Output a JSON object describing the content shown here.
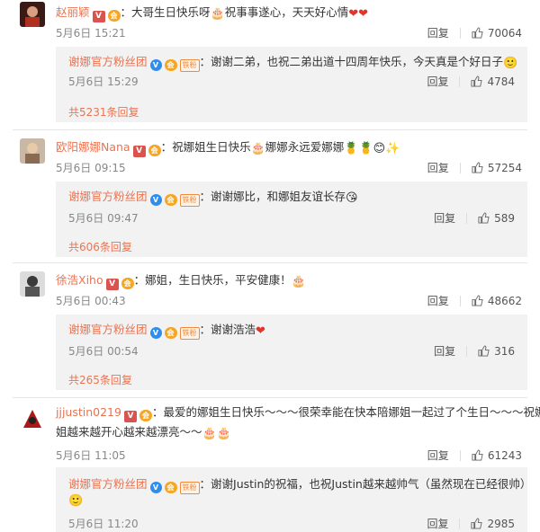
{
  "comments": [
    {
      "user": "赵丽颖",
      "text": "：大哥生日快乐呀",
      "text2": "祝事事遂心，天天好心情",
      "time": "5月6日 15:21",
      "reply_label": "回复",
      "likes": "70064",
      "sub": {
        "user": "谢娜官方粉丝团",
        "fan_tag": "铁粉",
        "text": "：谢谢二弟，也祝二弟出道十四周年快乐，今天真是个好日子",
        "time": "5月6日 15:29",
        "reply_label": "回复",
        "likes": "4784"
      },
      "more": "共5231条回复"
    },
    {
      "user": "欧阳娜娜Nana",
      "text": "：祝娜姐生日快乐",
      "text2": "娜娜永远爱娜娜",
      "time": "5月6日 09:15",
      "reply_label": "回复",
      "likes": "57254",
      "sub": {
        "user": "谢娜官方粉丝团",
        "fan_tag": "铁粉",
        "text": "：谢谢娜比，和娜姐友谊长存",
        "time": "5月6日 09:47",
        "reply_label": "回复",
        "likes": "589"
      },
      "more": "共606条回复"
    },
    {
      "user": "徐浩Xiho",
      "text": "：娜姐，生日快乐，平安健康！",
      "time": "5月6日 00:43",
      "reply_label": "回复",
      "likes": "48662",
      "sub": {
        "user": "谢娜官方粉丝团",
        "fan_tag": "铁粉",
        "text": "：谢谢浩浩",
        "time": "5月6日 00:54",
        "reply_label": "回复",
        "likes": "316"
      },
      "more": "共265条回复"
    },
    {
      "user": "jjjustin0219",
      "text": "：最爱的娜姐生日快乐～～～很荣幸能在快本陪娜姐一起过了个生日～～～祝娜",
      "text2": "姐越来越开心越来越漂亮～～",
      "time": "5月6日 11:05",
      "reply_label": "回复",
      "likes": "61243",
      "sub": {
        "user": "谢娜官方粉丝团",
        "fan_tag": "铁粉",
        "text": "：谢谢Justin的祝福，也祝Justin越来越帅气（虽然现在已经很帅）",
        "time": "5月6日 11:20",
        "reply_label": "回复",
        "likes": "2985"
      }
    }
  ],
  "icons": {
    "verified_v": "V",
    "vip_badge": "会",
    "blue_v": "V",
    "thumb": "thumb-up-icon"
  }
}
